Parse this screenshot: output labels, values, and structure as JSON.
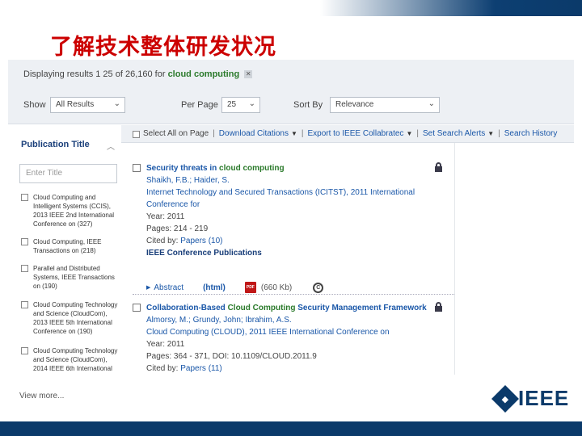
{
  "slide": {
    "title": "了解技术整体研发状况",
    "logo_text": "IEEE"
  },
  "results_bar": {
    "prefix": "Displaying results 1 25 of 26,160 for",
    "query": "cloud computing",
    "clear_icon": "x-icon"
  },
  "controls": {
    "show_label": "Show",
    "show_value": "All Results",
    "per_page_label": "Per Page",
    "per_page_value": "25",
    "sort_label": "Sort By",
    "sort_value": "Relevance"
  },
  "toolbar": {
    "select_all": "Select All on Page",
    "items": [
      "Download Citations",
      "Export to IEEE Collabratec",
      "Set Search Alerts",
      "Search History"
    ]
  },
  "sidebar": {
    "heading": "Publication Title",
    "filter_placeholder": "Enter Title",
    "facets": [
      "Cloud Computing and Intelligent Systems (CCIS), 2013 IEEE 2nd International Conference on (327)",
      "Cloud Computing, IEEE Transactions on (218)",
      "Parallel and Distributed Systems, IEEE Transactions on (190)",
      "Cloud Computing Technology and Science (CloudCom), 2013 IEEE 5th International Conference on (190)",
      "Cloud Computing Technology and Science (CloudCom), 2014 IEEE 6th International Conference on (181)"
    ],
    "view_more": "View more..."
  },
  "results": [
    {
      "title_prefix": "Security threats in ",
      "title_hl": "cloud computing",
      "title_suffix": "",
      "authors": "Shaikh, F.B.; Haider, S.",
      "venue": "Internet Technology and Secured Transactions (ICITST), 2011 International Conference for",
      "year": "Year: 2011",
      "pages": "Pages: 214 - 219",
      "cited_prefix": "Cited by: ",
      "cited_link": "Papers (10)",
      "publisher": "IEEE Conference Publications",
      "abstract": "Abstract",
      "html": "(html)",
      "pdf_icon": "pdf-icon",
      "pdf_size": "(660 Kb)",
      "copyright_icon": "copyright-icon"
    },
    {
      "title_prefix": "Collaboration-Based ",
      "title_hl": "Cloud Computing",
      "title_suffix": " Security Management Framework",
      "authors": "Almorsy, M.; Grundy, John; Ibrahim, A.S.",
      "venue": "Cloud Computing (CLOUD), 2011 IEEE International Conference on",
      "year": "Year: 2011",
      "pages": "Pages: 364 - 371, DOI: 10.1109/CLOUD.2011.9",
      "cited_prefix": "Cited by: ",
      "cited_link": "Papers (11)"
    }
  ]
}
